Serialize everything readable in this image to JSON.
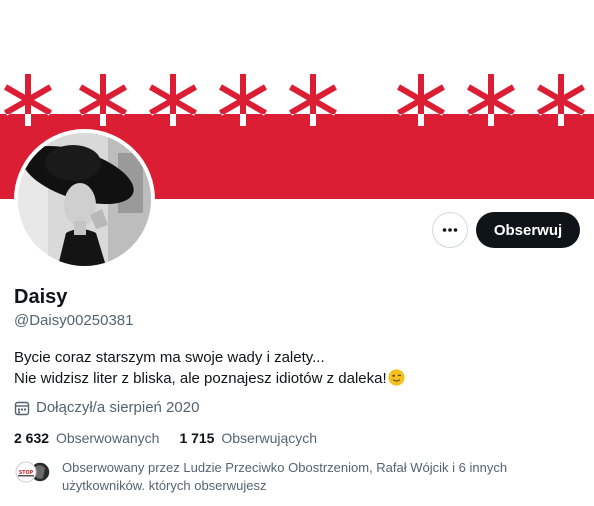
{
  "profile": {
    "name": "Daisy",
    "handle": "@Daisy00250381",
    "bio_line1": "Bycie coraz starszym ma swoje wady i zalety...",
    "bio_line2": "Nie widzisz liter z bliska, ale poznajesz idiotów z daleka!",
    "joined": "Dołączył/a sierpień 2020"
  },
  "actions": {
    "follow_label": "Obserwuj",
    "more_icon": "more-horizontal-icon"
  },
  "stats": {
    "following_count": "2 632",
    "following_label": "Obserwowanych",
    "followers_count": "1 715",
    "followers_label": "Obserwujących"
  },
  "followed_by": {
    "text": "Obserwowany przez Ludzie Przeciwko Obostrzeniom, Rafał Wójcik i 6 innych użytkowników. których obserwujesz"
  },
  "colors": {
    "banner_red": "#dc1e35",
    "follow_button_bg": "#0f1419",
    "secondary_text": "#536471"
  }
}
